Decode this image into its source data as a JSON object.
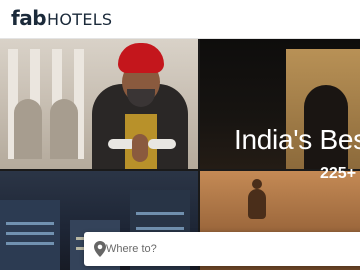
{
  "header": {
    "logo": {
      "part1": "fab",
      "part2": "HOTELS"
    }
  },
  "hero": {
    "title": "India's Bes",
    "subtitle": "225+"
  },
  "search": {
    "placeholder": "Where to?",
    "icon": "location-pin-icon"
  },
  "colors": {
    "logo_dark": "#1b2a3a",
    "header_bg": "#ffffff",
    "turban_red": "#c4161c",
    "text_on_image": "#ffffff"
  }
}
